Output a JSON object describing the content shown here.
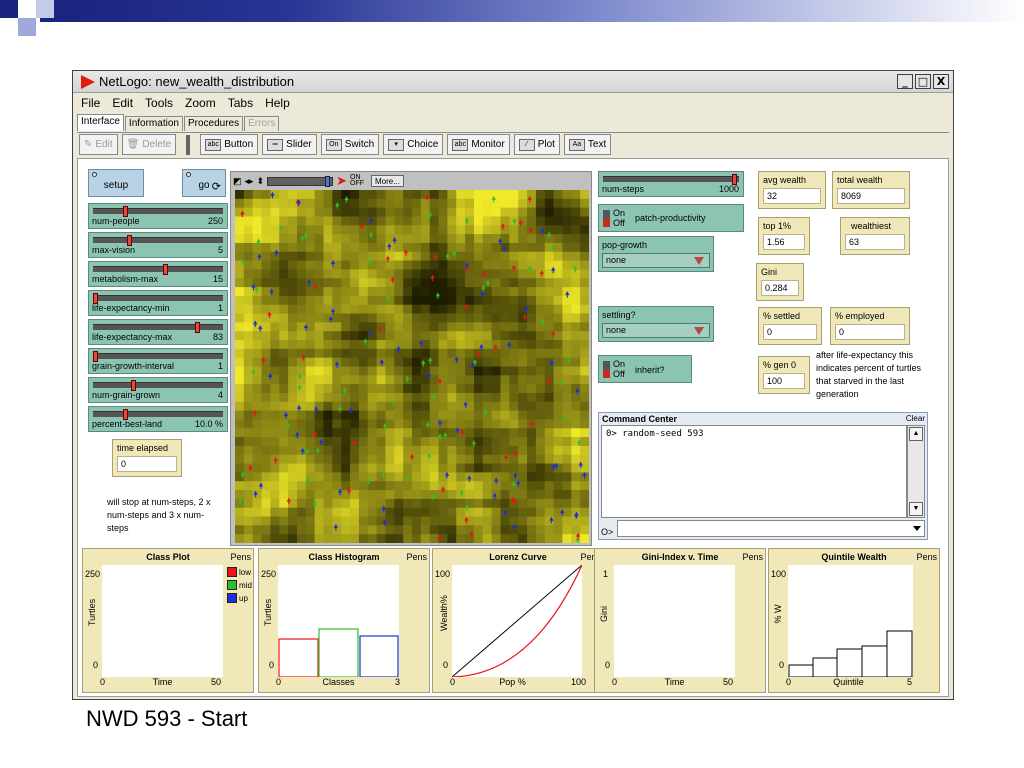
{
  "window": {
    "title": "NetLogo: new_wealth_distribution",
    "controls": [
      "_",
      "□",
      "X"
    ]
  },
  "menu": [
    "File",
    "Edit",
    "Tools",
    "Zoom",
    "Tabs",
    "Help"
  ],
  "tabs": [
    {
      "label": "Interface",
      "state": "active"
    },
    {
      "label": "Information",
      "state": "normal"
    },
    {
      "label": "Procedures",
      "state": "normal"
    },
    {
      "label": "Errors",
      "state": "disabled"
    }
  ],
  "toolbar": {
    "edit": "Edit",
    "delete": "Delete",
    "button": "Button",
    "slider": "Slider",
    "switch": "Switch",
    "choice": "Choice",
    "monitor": "Monitor",
    "plot": "Plot",
    "text": "Text"
  },
  "buttons": {
    "setup": "setup",
    "go": "go"
  },
  "sliders": [
    {
      "name": "num-people",
      "value": "250",
      "fraction": 0.24
    },
    {
      "name": "max-vision",
      "value": "5",
      "fraction": 0.27
    },
    {
      "name": "metabolism-max",
      "value": "15",
      "fraction": 0.55
    },
    {
      "name": "life-expectancy-min",
      "value": "1",
      "fraction": 0.0
    },
    {
      "name": "life-expectancy-max",
      "value": "83",
      "fraction": 0.8
    },
    {
      "name": "grain-growth-interval",
      "value": "1",
      "fraction": 0.0
    },
    {
      "name": "num-grain-grown",
      "value": "4",
      "fraction": 0.3
    },
    {
      "name": "percent-best-land",
      "value": "10.0 %",
      "fraction": 0.24
    }
  ],
  "time_elapsed": {
    "label": "time elapsed",
    "value": "0"
  },
  "note_steps": "will stop at num-steps, 2 x num-steps and 3 x num-steps",
  "view": {
    "more": "More...",
    "onoff": "ON OFF"
  },
  "right_panel": {
    "num_steps": {
      "name": "num-steps",
      "value": "1000",
      "fraction": 1.0
    },
    "patch_productivity": {
      "on": "On",
      "off": "Off",
      "name": "patch-productivity"
    },
    "pop_growth": {
      "name": "pop-growth",
      "value": "none"
    },
    "settling": {
      "name": "settling?",
      "value": "none"
    },
    "inherit": {
      "on": "On",
      "off": "Off",
      "name": "inherit?"
    },
    "monitors": {
      "avg_wealth": {
        "label": "avg wealth",
        "value": "32"
      },
      "total_wealth": {
        "label": "total wealth",
        "value": "8069"
      },
      "top1": {
        "label": "top 1%",
        "value": "1.56"
      },
      "wealthiest": {
        "label": "wealthiest",
        "value": "63"
      },
      "gini": {
        "label": "Gini",
        "value": "0.284"
      },
      "settled": {
        "label": "% settled",
        "value": "0"
      },
      "employed": {
        "label": "% employed",
        "value": "0"
      },
      "gen0": {
        "label": "% gen 0",
        "value": "100"
      }
    },
    "gen0_note": "after life-expectancy this indicates percent of turtles that starved in the last generation"
  },
  "command_center": {
    "title": "Command Center",
    "clear": "Clear",
    "output": "0> random-seed 593",
    "prompt": "O>"
  },
  "plots": {
    "class_plot": {
      "title": "Class Plot",
      "pens": "Pens",
      "ymax": "250",
      "ymin": "0",
      "xmin": "0",
      "xmax": "50",
      "xlabel": "Time",
      "ylabel": "Turtles",
      "legend": [
        {
          "label": "low",
          "color": "#e8141b"
        },
        {
          "label": "mid",
          "color": "#2fbf2a"
        },
        {
          "label": "up",
          "color": "#1d2fd8"
        }
      ]
    },
    "class_histogram": {
      "title": "Class Histogram",
      "pens": "Pens",
      "ymax": "250",
      "ymin": "0",
      "xmin": "0",
      "xmax": "3",
      "xlabel": "Classes",
      "ylabel": "Turtles"
    },
    "lorenz": {
      "title": "Lorenz Curve",
      "pens": "Pens",
      "ymax": "100",
      "ymin": "0",
      "xmin": "0",
      "xmax": "100",
      "xlabel": "Pop %",
      "ylabel": "Wealth%"
    },
    "gini_time": {
      "title": "Gini-Index v. Time",
      "pens": "Pens",
      "ymax": "1",
      "ymin": "0",
      "xmin": "0",
      "xmax": "50",
      "xlabel": "Time",
      "ylabel": "Gini"
    },
    "quintile": {
      "title": "Quintile Wealth",
      "pens": "Pens",
      "ymax": "100",
      "ymin": "0",
      "xmin": "0",
      "xmax": "5",
      "xlabel": "Quintile",
      "ylabel": "% W"
    }
  },
  "caption": "NWD 593 - Start",
  "colors": {
    "button": "#b8d2e6",
    "slider": "#8cc4b4",
    "monitor": "#f0e8b8",
    "command_center": "#e6ebf3",
    "low": "#e8141b",
    "mid": "#2fbf2a",
    "up": "#1d2fd8"
  }
}
